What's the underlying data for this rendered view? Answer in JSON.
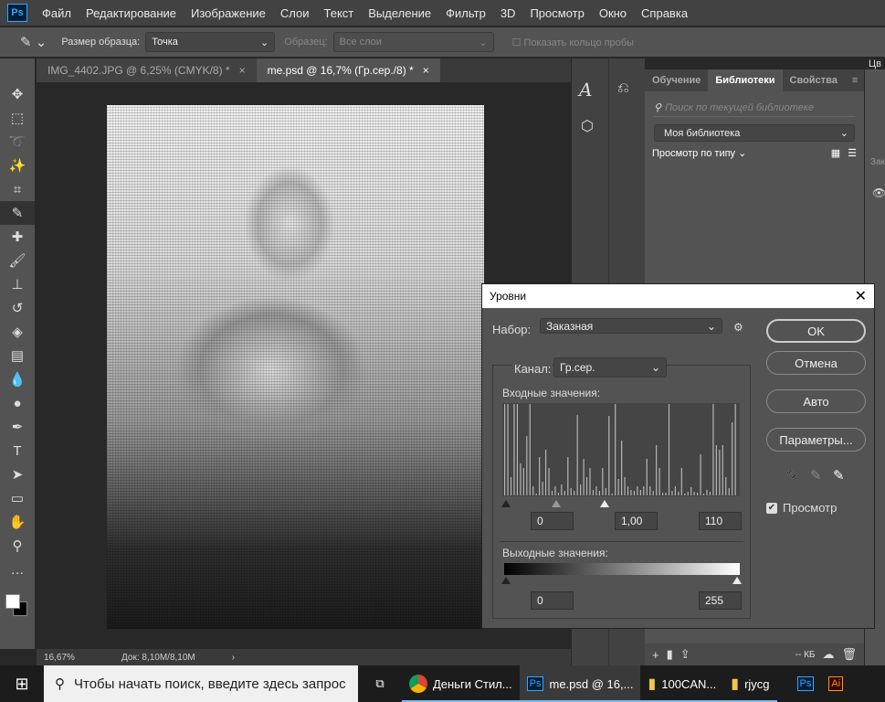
{
  "menu": [
    "Файл",
    "Редактирование",
    "Изображение",
    "Слои",
    "Текст",
    "Выделение",
    "Фильтр",
    "3D",
    "Просмотр",
    "Окно",
    "Справка"
  ],
  "app_logo": "Ps",
  "options": {
    "sample_size_label": "Размер образца:",
    "sample_size_value": "Точка",
    "sample_label": "Образец:",
    "sample_value": "Все слои",
    "show_ring_label": "Показать кольцо пробы"
  },
  "tabs": [
    {
      "label": "IMG_4402.JPG @ 6,25% (CMYK/8) *",
      "active": false
    },
    {
      "label": "me.psd @ 16,7% (Гр.сер./8) *",
      "active": true
    }
  ],
  "tools": [
    "move-icon",
    "marquee-icon",
    "lasso-icon",
    "magic-wand-icon",
    "crop-icon",
    "eyedropper-icon",
    "healing-icon",
    "brush-icon",
    "stamp-icon",
    "history-brush-icon",
    "eraser-icon",
    "gradient-icon",
    "blur-icon",
    "dodge-icon",
    "pen-icon",
    "type-icon",
    "path-select-icon",
    "rectangle-icon",
    "hand-icon",
    "zoom-icon",
    "more-icon"
  ],
  "status": {
    "zoom": "16,67%",
    "doc": "Док: 8,10M/8,10M"
  },
  "library": {
    "tabs": [
      "Обучение",
      "Библиотеки",
      "Свойства"
    ],
    "active_tab": 1,
    "search_placeholder": "Поиск по текущей библиотеке",
    "library_name": "Моя библиотека",
    "view_by": "Просмотр по типу",
    "size": "-- КБ"
  },
  "right_partial": {
    "tab": "Цв",
    "label": "Зак"
  },
  "levels": {
    "title": "Уровни",
    "preset_label": "Набор:",
    "preset_value": "Заказная",
    "channel_label": "Канал:",
    "channel_value": "Гр.сер.",
    "input_label": "Входные значения:",
    "input_black": "0",
    "input_gamma": "1,00",
    "input_white": "110",
    "output_label": "Выходные значения:",
    "output_black": "0",
    "output_white": "255",
    "buttons": {
      "ok": "OK",
      "cancel": "Отмена",
      "auto": "Авто",
      "options": "Параметры..."
    },
    "preview_label": "Просмотр",
    "preview_checked": true,
    "histogram": [
      1,
      1,
      0.2,
      1,
      1,
      0.35,
      0.3,
      0.65,
      1,
      0.1,
      0.02,
      0.42,
      0.15,
      0.5,
      0.3,
      0.05,
      0.1,
      0.03,
      0.12,
      0.05,
      0.42,
      0.08,
      0.05,
      0.88,
      0.12,
      0.4,
      0.2,
      0.3,
      0.06,
      0.1,
      0.05,
      0.3,
      0.08,
      0.87,
      0.02,
      1,
      0.18,
      0.6,
      0.2,
      0.1,
      0.06,
      0.05,
      0.1,
      0.06,
      0.1,
      0.4,
      0.1,
      0.05,
      0.55,
      0.3,
      0.03,
      0.03,
      1,
      0.05,
      0.1,
      0.04,
      0.3,
      0.02,
      0.04,
      0.09,
      0.04,
      0.03,
      0.45,
      0.02,
      0.06,
      0.04,
      1,
      0.55,
      0.5,
      0.55,
      0.2,
      0.08,
      0.8,
      1
    ]
  },
  "taskbar": {
    "search_placeholder": "Чтобы начать поиск, введите здесь запрос",
    "items": [
      {
        "label": "Деньги Стил...",
        "icon": "chrome-icon"
      },
      {
        "label": "me.psd @ 16,...",
        "icon": "photoshop-icon",
        "active": true
      },
      {
        "label": "100CAN...",
        "icon": "folder-icon"
      },
      {
        "label": "rjycg",
        "icon": "folder-icon"
      },
      {
        "label": "",
        "icon": "photoshop-icon"
      },
      {
        "label": "",
        "icon": "illustrator-icon"
      }
    ]
  },
  "colors": {
    "accent": "#31a8ff",
    "panel": "#535353",
    "dark": "#282828"
  }
}
